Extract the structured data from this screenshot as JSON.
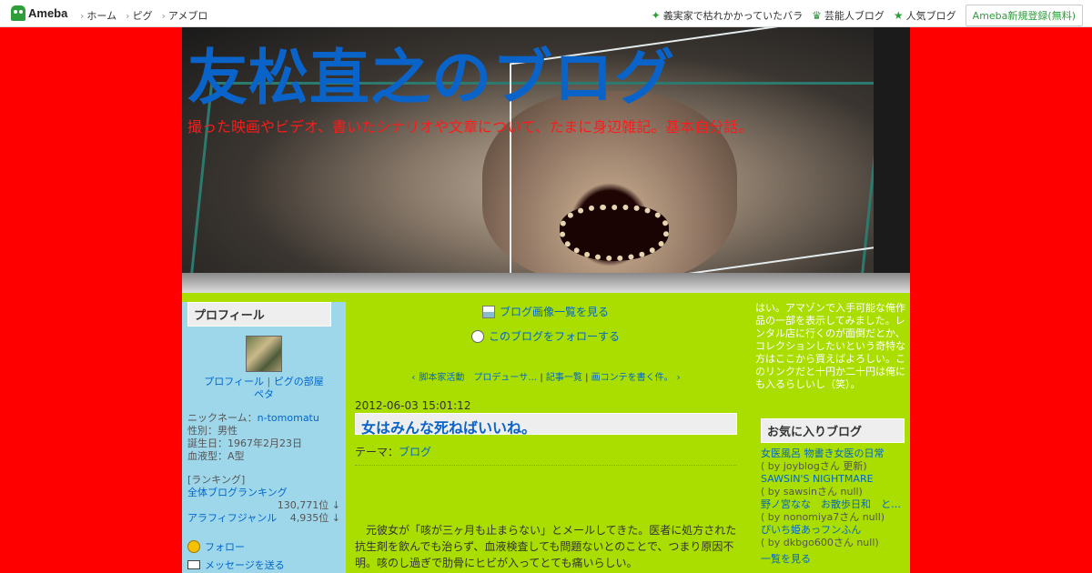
{
  "topbar": {
    "logo_text": "Ameba",
    "nav": [
      "ホーム",
      "ピグ",
      "アメブロ"
    ],
    "right_links": [
      {
        "icon": "sparkle-icon",
        "label": "義実家で枯れかかっていたバラ"
      },
      {
        "icon": "crown-icon",
        "label": "芸能人ブログ"
      },
      {
        "icon": "star-icon",
        "label": "人気ブログ"
      }
    ],
    "register_label": "Ameba新規登録(無料)"
  },
  "header": {
    "title": "友松直之のブログ",
    "description": "撮った映画やビデオ、書いたシナリオや文章について、たまに身辺雑記。基本自分話。"
  },
  "profile": {
    "title": "プロフィール",
    "links": [
      "プロフィール",
      "ピグの部屋",
      "ペタ"
    ],
    "nickname_label": "ニックネーム：",
    "nickname": "n-tomomatu",
    "gender": "性別：男性",
    "birthday": "誕生日：1967年2月23日",
    "blood": "血液型：A型",
    "ranking_label": "[ランキング]",
    "ranking_all": "全体ブログランキング",
    "ranking_all_value": "130,771位 ↓",
    "ranking_genre": "アラフィフジャンル",
    "ranking_genre_value": "4,935位 ↓",
    "follow_label": "フォロー",
    "mail_label": "メッセージを送る"
  },
  "center": {
    "images_link": "ブログ画像一覧を見る",
    "follow_link": "このブログをフォローする",
    "nav_prev": "脚本家活動　プロデューサ…",
    "nav_list": "記事一覧",
    "nav_next": "画コンテを書く件。",
    "entry_date": "2012-06-03 15:01:12",
    "entry_title": "女はみんな死ねばいいね。",
    "theme_label": "テーマ：",
    "theme": "ブログ",
    "body": "元彼女が「咳が三ヶ月も止まらない」とメールしてきた。医者に処方された抗生剤を飲んでも治らず、血液検査しても問題ないとのことで、つまり原因不明。咳のし過ぎで肋骨にヒビが入ってとても痛いらしい。"
  },
  "right": {
    "text": "はい。アマゾンで入手可能な俺作品の一部を表示してみました。レンタル店に行くのが面倒だとか、コレクションしたいという奇特な方はここから買えばよろしい。このリンクだと十円か二十円は俺にも入るらしいし（笑）。",
    "fav_title": "お気に入りブログ",
    "favorites": [
      {
        "name": "女医風呂 物書き女医の日常",
        "by": "( by joyblogさん 更新)"
      },
      {
        "name": "SAWSIN'S NIGHTMARE",
        "by": "( by sawsinさん null)"
      },
      {
        "name": "野ノ宮なな　お散歩日和　と…",
        "by": "( by nonomiya7さん null)"
      },
      {
        "name": "ぴいち姫あっフンふん",
        "by": "( by dkbgo600さん null)"
      }
    ],
    "fav_all": "一覧を見る"
  },
  "colors": {
    "background": "#ff0000",
    "content": "#aadd00",
    "sidebar": "#9fd7ea",
    "title": "#0a63c9",
    "link": "#0066cc"
  }
}
